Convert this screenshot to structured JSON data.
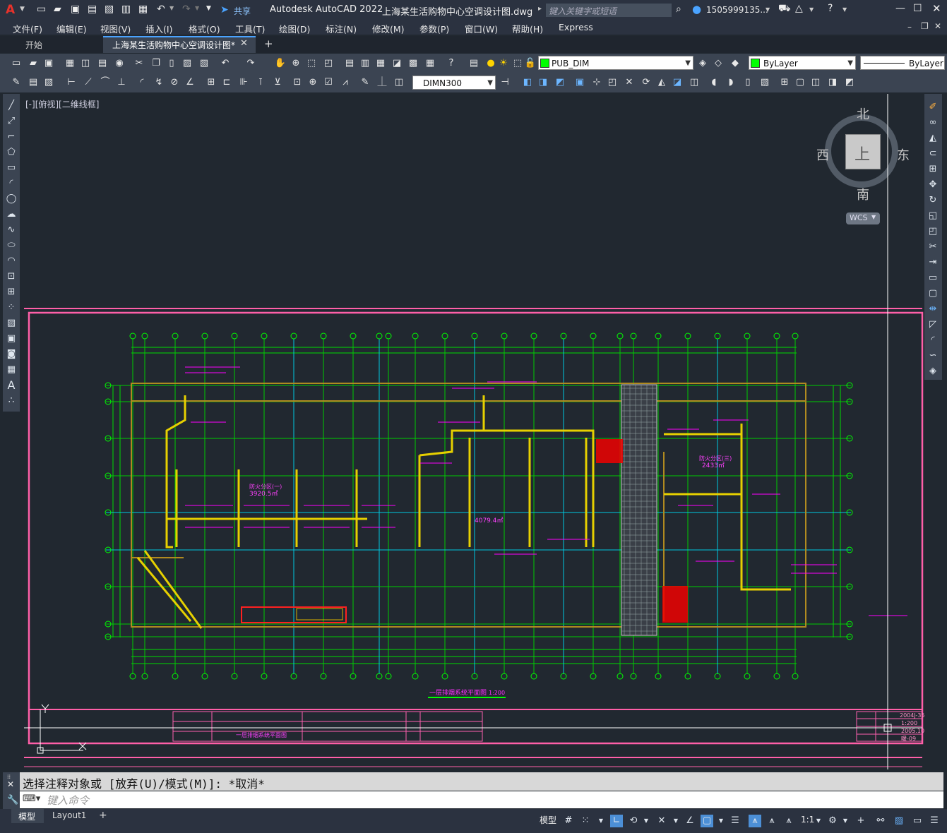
{
  "app": {
    "product": "Autodesk AutoCAD 2022",
    "document_title": "上海某生活购物中心空调设计图.dwg",
    "share_label": "共享",
    "search_placeholder": "键入关键字或短语",
    "user": "1505999135...",
    "logo_letter": "A"
  },
  "menu": [
    "文件(F)",
    "编辑(E)",
    "视图(V)",
    "插入(I)",
    "格式(O)",
    "工具(T)",
    "绘图(D)",
    "标注(N)",
    "修改(M)",
    "参数(P)",
    "窗口(W)",
    "帮助(H)",
    "Express"
  ],
  "tabs": [
    {
      "label": "开始",
      "active": false
    },
    {
      "label": "上海某生活购物中心空调设计图*",
      "active": true
    }
  ],
  "toolbar": {
    "layer_name": "PUB_DIM",
    "color_value": "ByLayer",
    "linetype_value": "ByLayer",
    "dimstyle_value": "DIMN300"
  },
  "viewport": {
    "label": "[-][俯视][二维线框]",
    "viewcube": {
      "north": "北",
      "south": "南",
      "east": "东",
      "west": "西",
      "top": "上",
      "wcs": "WCS"
    }
  },
  "drawing": {
    "title": "一层排烟系统平面图",
    "scale": "1:200",
    "area_label_1": "3920.5㎡",
    "area_label_2": "2433㎡",
    "area_label_3": "4079.4㎡",
    "titleblock_name": "一层排烟系统平面图",
    "titleblock_number": "2004J-35",
    "titleblock_scale": "1:200",
    "titleblock_date": "2005.10",
    "titleblock_sheet": "暖-09"
  },
  "command": {
    "history": "选择注释对象或 [放弃(U)/模式(M)]: *取消*",
    "input_placeholder": "键入命令"
  },
  "status": {
    "layout_tabs": [
      "模型",
      "Layout1"
    ],
    "model_label": "模型",
    "scale": "1:1"
  },
  "colors": {
    "background": "#212830",
    "grid_green": "#00ff00",
    "duct_yellow": "#e6d000",
    "annot_magenta": "#ff00ff",
    "axis_cyan": "#00ffff",
    "frame_pink": "#ff6fb0",
    "wall_brown": "#a08020",
    "fire_red": "#ff0000"
  }
}
